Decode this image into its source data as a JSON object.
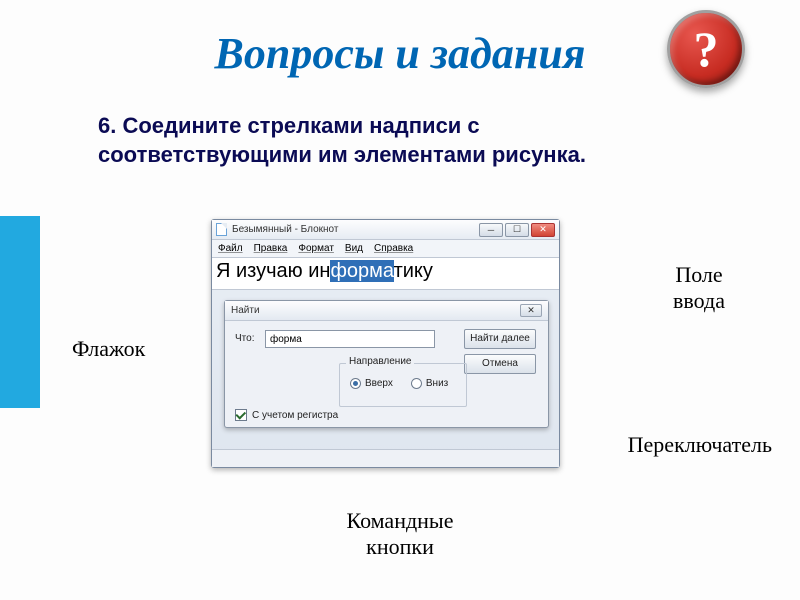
{
  "title": "Вопросы и задания",
  "badge_mark": "?",
  "task": "6. Соедините стрелками надписи с соответствующими им элементами рисунка.",
  "labels": {
    "flag": "Флажок",
    "input_field_l1": "Поле",
    "input_field_l2": "ввода",
    "switch": "Переключатель",
    "command_buttons_l1": "Командные",
    "command_buttons_l2": "кнопки"
  },
  "notepad": {
    "window_title": "Безымянный - Блокнот",
    "menu": [
      "Файл",
      "Правка",
      "Формат",
      "Вид",
      "Справка"
    ],
    "text_pre": "Я изучаю ин",
    "text_sel": "форма",
    "text_post": "тику"
  },
  "find": {
    "title": "Найти",
    "what_label": "Что:",
    "what_value": "форма",
    "next_btn": "Найти далее",
    "cancel_btn": "Отмена",
    "direction_label": "Направление",
    "dir_up": "Вверх",
    "dir_down": "Вниз",
    "checked_direction": "up",
    "case_label": "С учетом регистра",
    "case_checked": true
  },
  "win_controls": {
    "min": "─",
    "max": "☐",
    "close": "✕"
  }
}
